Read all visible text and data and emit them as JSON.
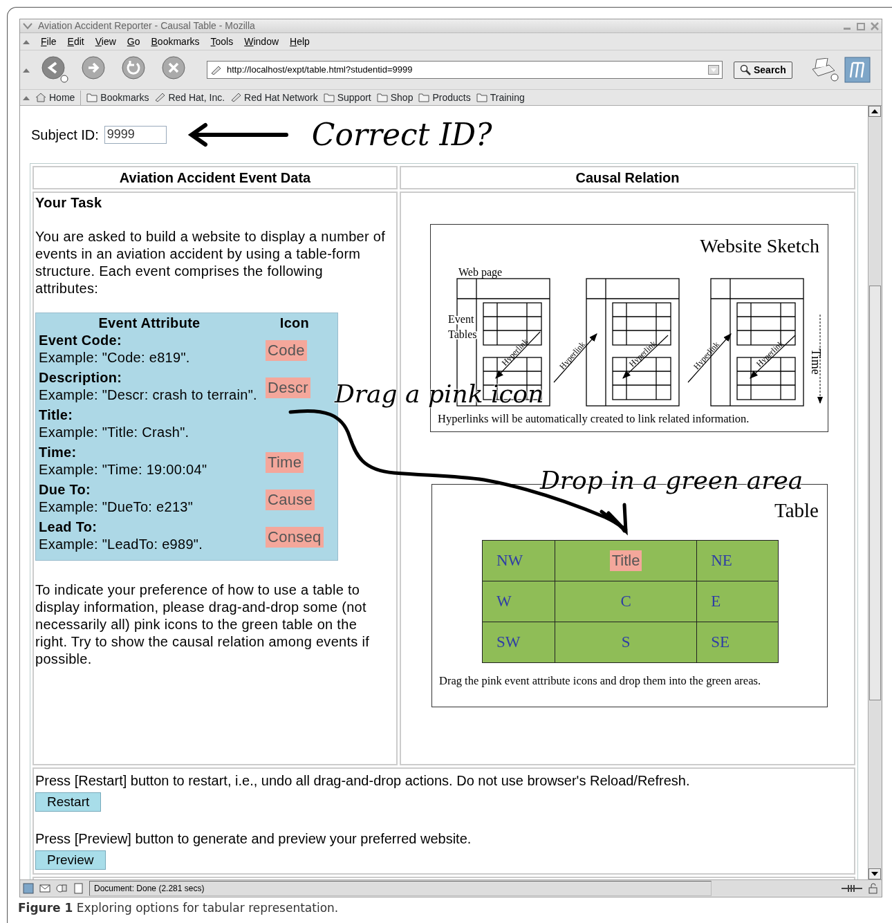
{
  "window": {
    "title": "Aviation Accident Reporter - Causal Table - Mozilla"
  },
  "menu": [
    "File",
    "Edit",
    "View",
    "Go",
    "Bookmarks",
    "Tools",
    "Window",
    "Help"
  ],
  "toolbar": {
    "url": "http://localhost/expt/table.html?studentid=9999",
    "search_button": "Search"
  },
  "bookmarks": [
    {
      "label": "Home",
      "kind": "home"
    },
    {
      "label": "Bookmarks",
      "kind": "folder"
    },
    {
      "label": "Red Hat, Inc.",
      "kind": "link"
    },
    {
      "label": "Red Hat Network",
      "kind": "link"
    },
    {
      "label": "Support",
      "kind": "folder"
    },
    {
      "label": "Shop",
      "kind": "folder"
    },
    {
      "label": "Products",
      "kind": "folder"
    },
    {
      "label": "Training",
      "kind": "folder"
    }
  ],
  "subject": {
    "label": "Subject ID:",
    "value": "9999",
    "annotation": "Correct ID?"
  },
  "left_panel": {
    "heading": "Aviation Accident Event Data",
    "task_title": "Your Task",
    "intro": "You are asked to build a website to display a number of events in an aviation accident by using a table-form structure. Each event comprises the following attributes:",
    "attribute_columns": [
      "Event Attribute",
      "Icon"
    ],
    "attributes": [
      {
        "name": "Event Code:",
        "example": "Example: \"Code: e819\".",
        "icon": "Code"
      },
      {
        "name": "Description:",
        "example": "Example: \"Descr: crash to terrain\".",
        "icon": "Descr"
      },
      {
        "name": "Title:",
        "example": "Example: \"Title: Crash\"."
      },
      {
        "name": "Time:",
        "example": "Example: \"Time: 19:00:04\"",
        "icon": "Time"
      },
      {
        "name": "Due To:",
        "example": "Example: \"DueTo: e213\"",
        "icon": "Cause"
      },
      {
        "name": "Lead To:",
        "example": "Example: \"LeadTo: e989\".",
        "icon": "Conseq"
      }
    ],
    "instructions": "To indicate your preference of how to use a table to display information, please drag-and-drop some (not necessarily all) pink icons to the green table on the right. Try to show the causal relation among events if possible."
  },
  "right_panel": {
    "heading": "Causal Relation",
    "sketch": {
      "title": "Website Sketch",
      "page_label": "Web page",
      "table_labels": [
        "Event",
        "Tables"
      ],
      "link_labels": [
        "Hyperlink",
        "Hyperlink",
        "Hyperlink",
        "Hyperlink",
        "Hyperlink"
      ],
      "time_label": "Time",
      "caption": "Hyperlinks will be automatically created to link related information."
    },
    "drop_table": {
      "title": "Table",
      "rows": [
        [
          {
            "label": "NW"
          },
          {
            "icon": "Title"
          },
          {
            "label": "NE"
          }
        ],
        [
          {
            "label": "W"
          },
          {
            "label": "C"
          },
          {
            "label": "E"
          }
        ],
        [
          {
            "label": "SW"
          },
          {
            "label": "S"
          },
          {
            "label": "SE"
          }
        ]
      ],
      "caption": "Drag the pink event attribute icons and drop them into the green areas."
    }
  },
  "annotations": {
    "drag": "Drag a pink icon",
    "drop": "Drop in a green area"
  },
  "footer": {
    "restart_text": "Press [Restart] button to restart, i.e., undo all drag-and-drop actions. Do not use browser's Reload/Refresh.",
    "restart_button": "Restart",
    "preview_text": "Press [Preview] button to generate and preview your preferred website.",
    "preview_button": "Preview"
  },
  "status_bar": {
    "text": "Document: Done (2.281 secs)"
  },
  "caption": "**Figure 1** Exploring options for tabular representation."
}
